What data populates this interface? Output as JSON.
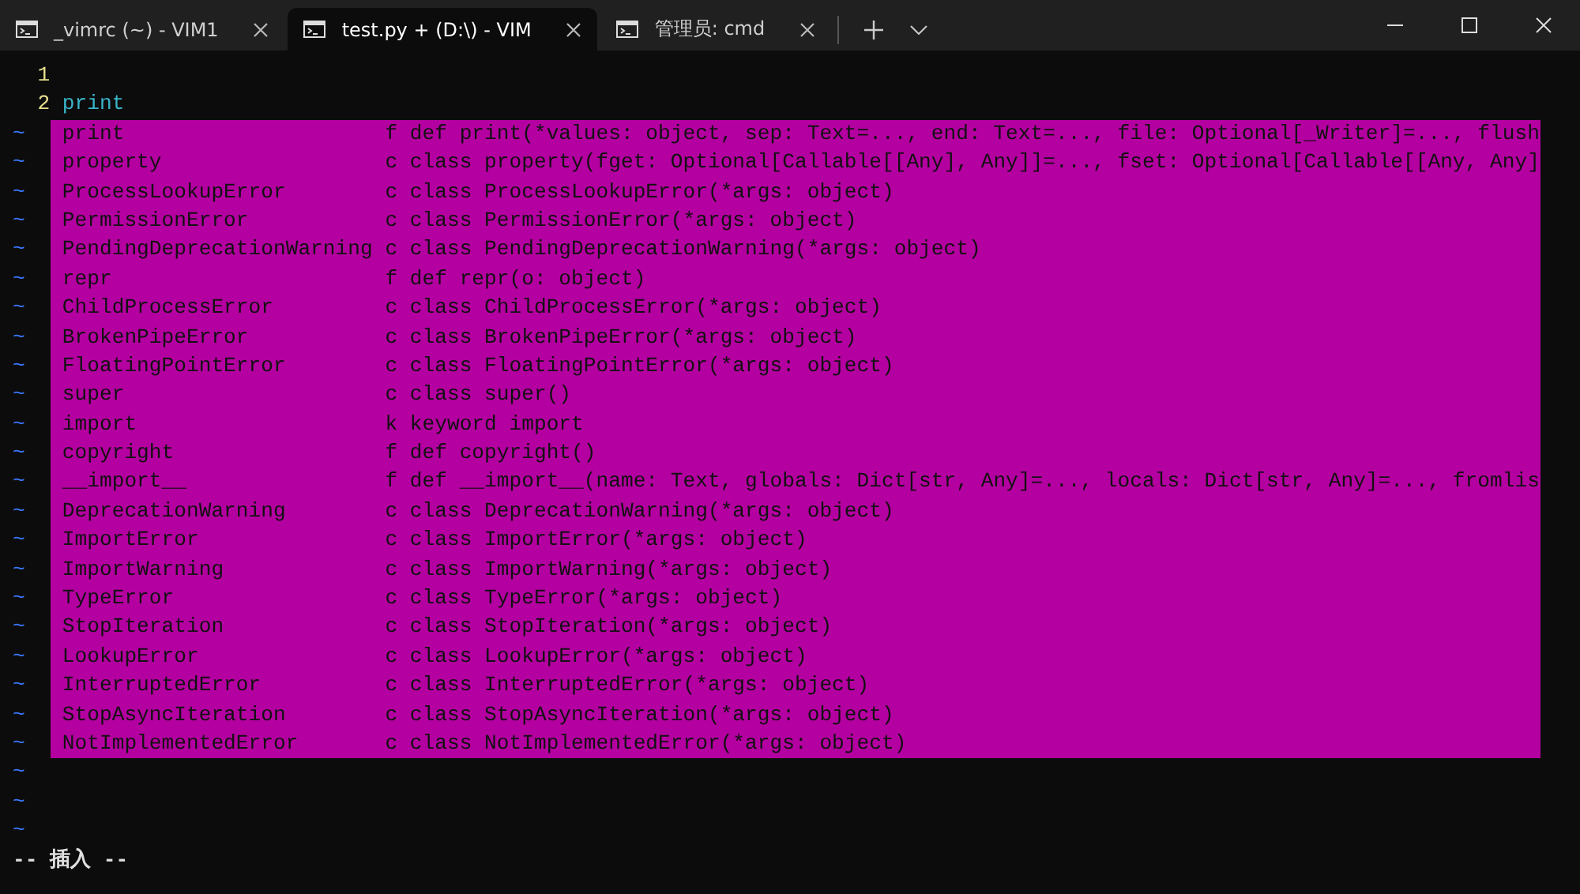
{
  "tabs": [
    {
      "title": "_vimrc (~) - VIM1",
      "selected": false
    },
    {
      "title": "test.py + (D:\\) - VIM",
      "selected": true
    },
    {
      "title": "管理员: cmd",
      "selected": false
    }
  ],
  "buffer": {
    "lines": [
      {
        "number": "1"
      },
      {
        "number": "2",
        "text": "print"
      }
    ],
    "filler_lines": [
      "~",
      "~",
      "~",
      "~",
      "~",
      "~",
      "~",
      "~",
      "~",
      "~",
      "~",
      "~",
      "~",
      "~",
      "~",
      "~",
      "~",
      "~",
      "~",
      "~",
      "~",
      "~",
      "~",
      "~",
      "~"
    ]
  },
  "completion_menu": {
    "items": [
      {
        "word": "print",
        "kind": "f",
        "info": "def print(*values: object, sep: Text=..., end: Text=..., file: Optional[_Writer]=..., flush",
        "selected": false
      },
      {
        "word": "property",
        "kind": "c",
        "info": "class property(fget: Optional[Callable[[Any], Any]]=..., fset: Optional[Callable[[Any, Any]",
        "selected": false
      },
      {
        "word": "ProcessLookupError",
        "kind": "c",
        "info": "class ProcessLookupError(*args: object)",
        "selected": false
      },
      {
        "word": "PermissionError",
        "kind": "c",
        "info": "class PermissionError(*args: object)",
        "selected": false
      },
      {
        "word": "PendingDeprecationWarning",
        "kind": "c",
        "info": "class PendingDeprecationWarning(*args: object)",
        "selected": false
      },
      {
        "word": "repr",
        "kind": "f",
        "info": "def repr(o: object)",
        "selected": false
      },
      {
        "word": "ChildProcessError",
        "kind": "c",
        "info": "class ChildProcessError(*args: object)",
        "selected": false
      },
      {
        "word": "BrokenPipeError",
        "kind": "c",
        "info": "class BrokenPipeError(*args: object)",
        "selected": false
      },
      {
        "word": "FloatingPointError",
        "kind": "c",
        "info": "class FloatingPointError(*args: object)",
        "selected": false
      },
      {
        "word": "super",
        "kind": "c",
        "info": "class super()",
        "selected": false
      },
      {
        "word": "import",
        "kind": "k",
        "info": "keyword import",
        "selected": false
      },
      {
        "word": "copyright",
        "kind": "f",
        "info": "def copyright()",
        "selected": false
      },
      {
        "word": "__import__",
        "kind": "f",
        "info": "def __import__(name: Text, globals: Dict[str, Any]=..., locals: Dict[str, Any]=..., fromlis",
        "selected": false
      },
      {
        "word": "DeprecationWarning",
        "kind": "c",
        "info": "class DeprecationWarning(*args: object)",
        "selected": false
      },
      {
        "word": "ImportError",
        "kind": "c",
        "info": "class ImportError(*args: object)",
        "selected": false
      },
      {
        "word": "ImportWarning",
        "kind": "c",
        "info": "class ImportWarning(*args: object)",
        "selected": false
      },
      {
        "word": "TypeError",
        "kind": "c",
        "info": "class TypeError(*args: object)",
        "selected": false
      },
      {
        "word": "StopIteration",
        "kind": "c",
        "info": "class StopIteration(*args: object)",
        "selected": false
      },
      {
        "word": "LookupError",
        "kind": "c",
        "info": "class LookupError(*args: object)",
        "selected": false
      },
      {
        "word": "InterruptedError",
        "kind": "c",
        "info": "class InterruptedError(*args: object)",
        "selected": false
      },
      {
        "word": "StopAsyncIteration",
        "kind": "c",
        "info": "class StopAsyncIteration(*args: object)",
        "selected": false
      },
      {
        "word": "NotImplementedError",
        "kind": "c",
        "info": "class NotImplementedError(*args: object)",
        "selected": false
      }
    ]
  },
  "mode": "-- 插入 --"
}
